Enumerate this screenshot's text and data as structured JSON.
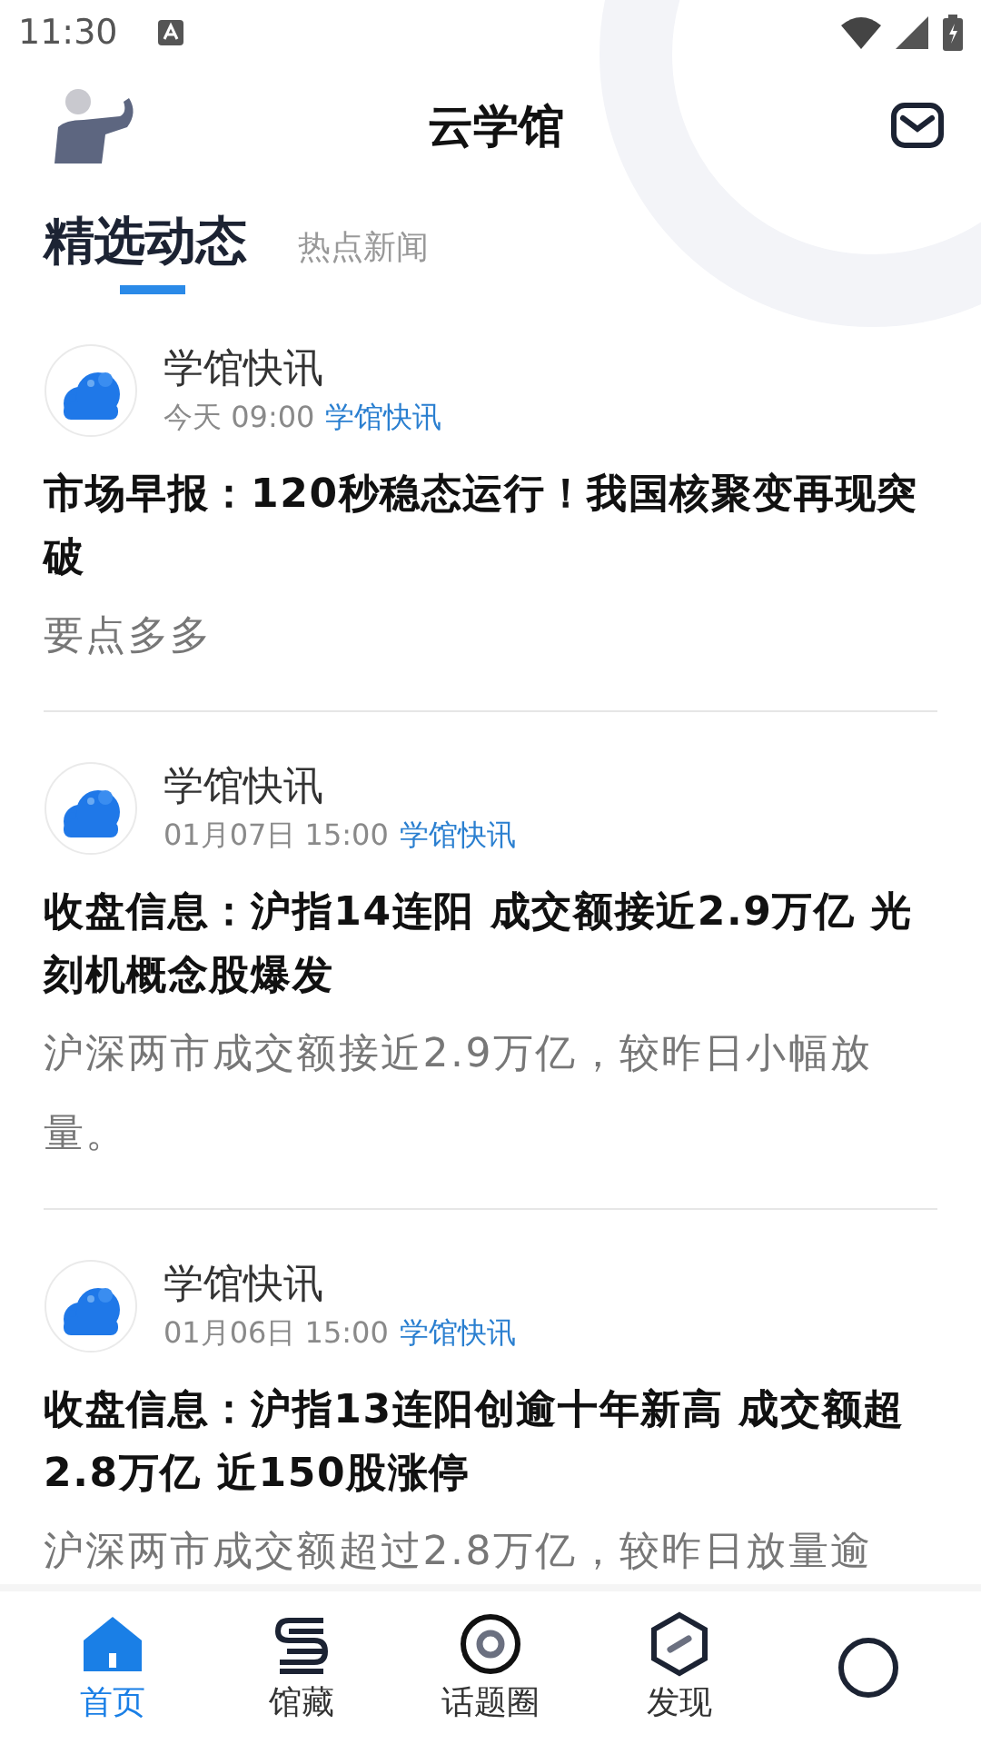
{
  "status_bar": {
    "time": "11:30"
  },
  "header": {
    "title": "云学馆"
  },
  "tabs": [
    {
      "label": "精选动态",
      "selected": true
    },
    {
      "label": "热点新闻",
      "selected": false
    }
  ],
  "articles": [
    {
      "source": "学馆快讯",
      "time": "今天 09:00",
      "tag": "学馆快讯",
      "title": "市场早报：120秒稳态运行！我国核聚变再现突破",
      "summary": "要点多多"
    },
    {
      "source": "学馆快讯",
      "time": "01月07日 15:00",
      "tag": "学馆快讯",
      "title": "收盘信息：沪指14连阳 成交额接近2.9万亿 光刻机概念股爆发",
      "summary": "沪深两市成交额接近2.9万亿，较昨日小幅放量。"
    },
    {
      "source": "学馆快讯",
      "time": "01月06日 15:00",
      "tag": "学馆快讯",
      "title": "收盘信息：沪指13连阳创逾十年新高 成交额超2.8万亿 近150股涨停",
      "summary": "沪深两市成交额超过2.8万亿，较昨日放量逾"
    }
  ],
  "bottom_nav": [
    {
      "kind": "home",
      "label": "首页",
      "selected": true
    },
    {
      "kind": "collection",
      "label": "馆藏",
      "selected": false
    },
    {
      "kind": "topics",
      "label": "话题圈",
      "selected": false
    },
    {
      "kind": "discover",
      "label": "发现",
      "selected": false
    },
    {
      "kind": "circle",
      "selected": false
    }
  ]
}
